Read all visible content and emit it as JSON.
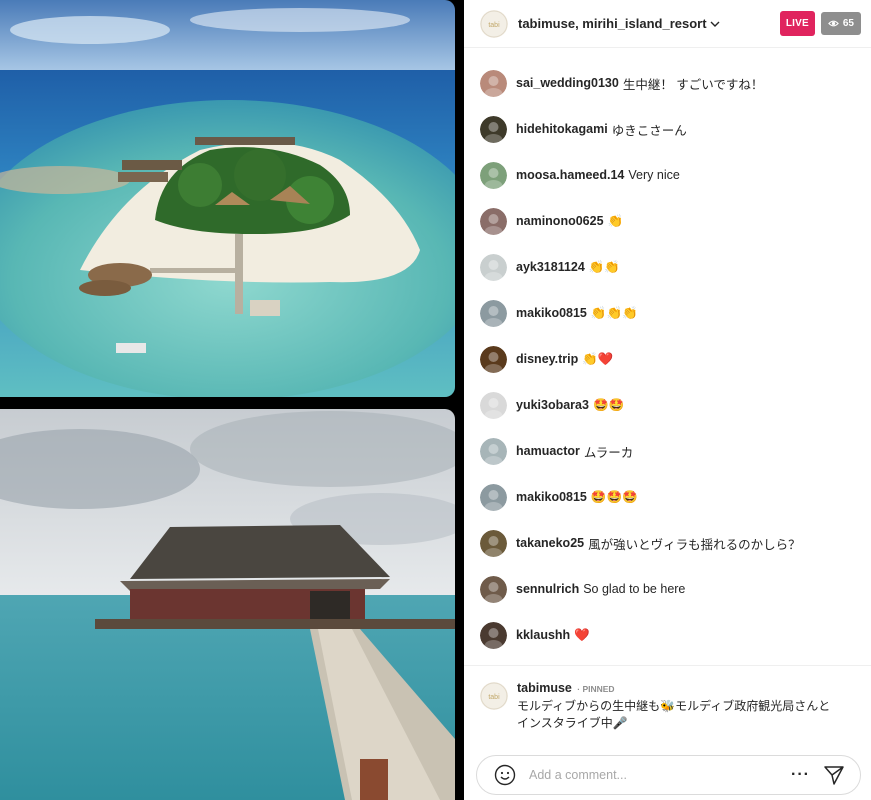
{
  "header": {
    "hosts": "tabimuse, mirihi_island_resort",
    "live_label": "LIVE",
    "viewer_count": "65"
  },
  "comments": [
    {
      "user": "sai_wedding0130",
      "text": "生中継！ すごいですね！",
      "avatar_color": "#b98a7a"
    },
    {
      "user": "hidehitokagami",
      "text": "ゆきこさーん",
      "avatar_color": "#3e3a2a"
    },
    {
      "user": "moosa.hameed.14",
      "text": "Very nice",
      "avatar_color": "#7da07a"
    },
    {
      "user": "naminono0625",
      "text": "👏",
      "avatar_color": "#8a6d68"
    },
    {
      "user": "ayk3181124",
      "text": "👏👏",
      "avatar_color": "#c9cfcf"
    },
    {
      "user": "makiko0815",
      "text": "👏👏👏",
      "avatar_color": "#8c9aa0"
    },
    {
      "user": "disney.trip",
      "text": "👏❤️",
      "avatar_color": "#5a3a1c"
    },
    {
      "user": "yuki3obara3",
      "text": "🤩🤩",
      "avatar_color": "#d9d9d9"
    },
    {
      "user": "hamuactor",
      "text": "ムラーカ",
      "avatar_color": "#a7b5b8"
    },
    {
      "user": "makiko0815",
      "text": "🤩🤩🤩",
      "avatar_color": "#8c9aa0"
    },
    {
      "user": "takaneko25",
      "text": "風が強いとヴィラも揺れるのかしら？",
      "avatar_color": "#6b5a3a"
    },
    {
      "user": "sennulrich",
      "text": "So glad to be here",
      "avatar_color": "#6f5b4a"
    },
    {
      "user": "kklaushh",
      "text": "❤️",
      "avatar_color": "#4a3a30"
    }
  ],
  "pinned": {
    "user": "tabimuse",
    "tag": "PINNED",
    "line1": "モルディブからの生中継も🐝モルディブ政府観光局さんと",
    "line2": "インスタライブ中🎤"
  },
  "composer": {
    "placeholder": "Add a comment..."
  },
  "colors": {
    "live": "#e0245e",
    "viewer_badge": "#8e8e8e"
  }
}
